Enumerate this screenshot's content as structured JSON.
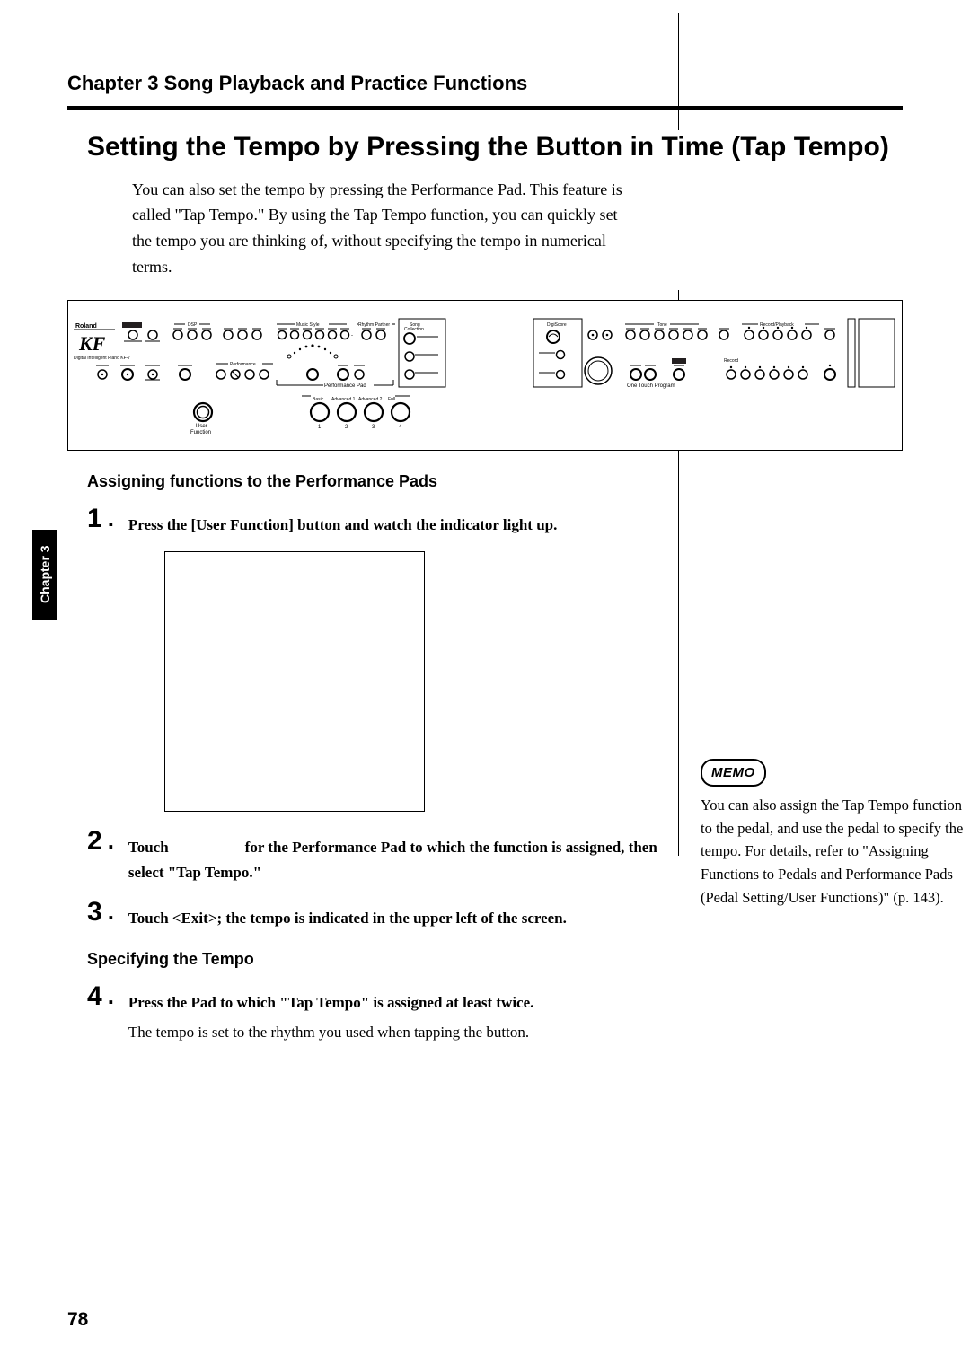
{
  "chapter_header": "Chapter 3 Song Playback and Practice Functions",
  "section_title": "Setting the Tempo by Pressing the Button in Time (Tap Tempo)",
  "intro": "You can also set the tempo by pressing the Performance Pad. This feature is called \"Tap Tempo.\" By using the Tap Tempo function, you can quickly set the tempo you are thinking of, without specifying the tempo in numerical terms.",
  "subheading1": "Assigning functions to the Performance Pads",
  "steps": {
    "s1": "Press the [User Function] button and watch the indicator light up.",
    "s2a": "Touch ",
    "s2b": " for the Performance Pad to which the function is assigned, then select \"Tap Tempo.\"",
    "s3": "Touch <Exit>; the tempo is indicated in the upper left of the screen.",
    "s4a": "Press the Pad to which \"Tap Tempo\" is assigned at least twice.",
    "s4b": "The tempo is set to the rhythm you used when tapping the button."
  },
  "subheading2": "Specifying the Tempo",
  "sidebar_tab": "Chapter 3",
  "memo_label": "MEMO",
  "memo_body": "You can also assign the Tap Tempo function to the pedal, and use the pedal to specify the tempo. For details, refer to \"Assigning Functions to Pedals and Performance Pads (Pedal Setting/User Functions)\" (p. 143).",
  "page_number": "78",
  "panel_labels": {
    "brand": "Roland",
    "song_collection": "Song\nCollection",
    "user_function": "User\nFunction",
    "performance_pad": "Performance Pad",
    "basic": "Basic",
    "adv1": "Advanced 1",
    "adv2": "Advanced 2",
    "full": "Full",
    "n1": "1",
    "n2": "2",
    "n3": "3",
    "n4": "4",
    "music_style": "Music Style",
    "rhythm_partner": "Rhythm Partner",
    "digiscore": "DigiScore",
    "one_touch": "One Touch Program",
    "record_playback": "Record/Playback",
    "tone": "Tone",
    "performance": "Performance"
  }
}
